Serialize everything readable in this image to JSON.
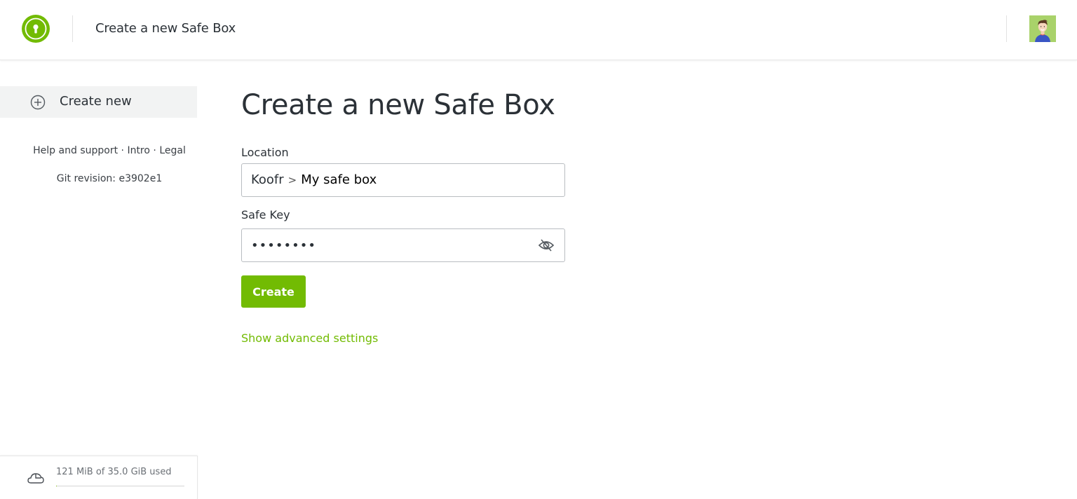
{
  "header": {
    "title": "Create a new Safe Box",
    "logo_icon": "keyhole-icon",
    "avatar_icon": "user-avatar",
    "brand_color": "#72bb03"
  },
  "sidebar": {
    "create_new": {
      "label": "Create new",
      "icon": "plus-circle-icon"
    },
    "footer_links": [
      {
        "label": "Help and support"
      },
      {
        "label": "Intro"
      },
      {
        "label": "Legal"
      }
    ],
    "separator": "·",
    "git_revision": "Git revision: e3902e1",
    "storage": {
      "text": "121 MiB of 35.0 GiB used",
      "used_fraction": 0.0034,
      "icon": "cloud-icon"
    }
  },
  "main": {
    "title": "Create a new Safe Box",
    "location": {
      "label": "Location",
      "root": "Koofr",
      "separator": ">",
      "current": "My safe box"
    },
    "safe_key": {
      "label": "Safe Key",
      "value": "••••••••",
      "toggle_icon": "eye-slash-icon"
    },
    "create_button": "Create",
    "advanced_link": "Show advanced settings"
  }
}
